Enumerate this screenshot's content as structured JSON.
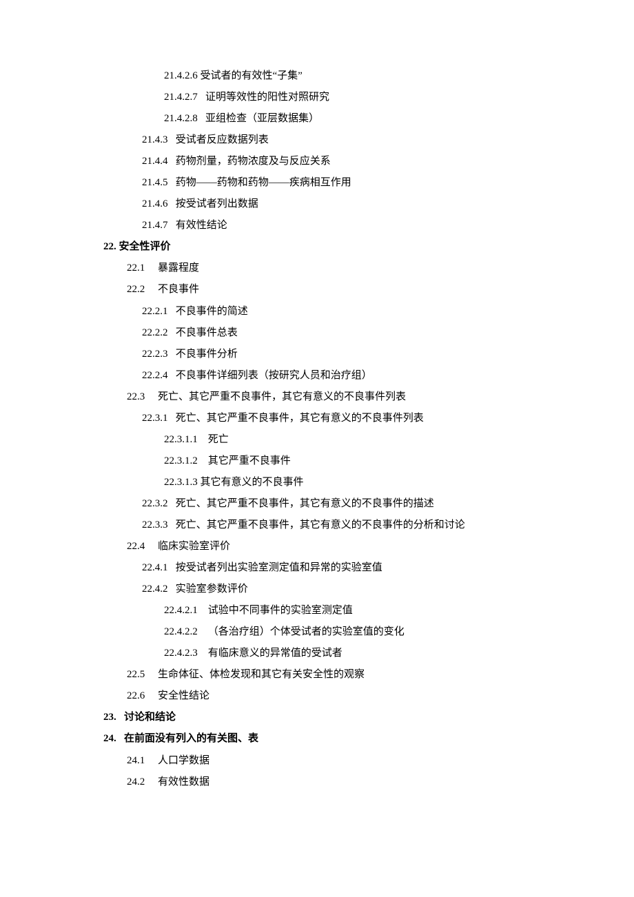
{
  "lines": [
    {
      "level": 3,
      "bold": false,
      "num": "21.4.2.6",
      "gap": " ",
      "text": "受试者的有效性“子集”"
    },
    {
      "level": 3,
      "bold": false,
      "num": "21.4.2.7",
      "gap": "   ",
      "text": "证明等效性的阳性对照研究"
    },
    {
      "level": 3,
      "bold": false,
      "num": "21.4.2.8",
      "gap": "   ",
      "text": "亚组检查（亚层数据集）"
    },
    {
      "level": 2,
      "bold": false,
      "num": "21.4.3",
      "gap": "   ",
      "text": "受试者反应数据列表"
    },
    {
      "level": 2,
      "bold": false,
      "num": "21.4.4",
      "gap": "   ",
      "text": "药物剂量，药物浓度及与反应关系"
    },
    {
      "level": 2,
      "bold": false,
      "num": "21.4.5",
      "gap": "   ",
      "text": "药物——药物和药物——疾病相互作用"
    },
    {
      "level": 2,
      "bold": false,
      "num": "21.4.6",
      "gap": "   ",
      "text": "按受试者列出数据"
    },
    {
      "level": 2,
      "bold": false,
      "num": "21.4.7",
      "gap": "   ",
      "text": "有效性结论"
    },
    {
      "level": 0,
      "bold": true,
      "num": "22.",
      "gap": " ",
      "text": "安全性评价"
    },
    {
      "level": 1,
      "bold": false,
      "num": "22.1",
      "gap": "     ",
      "text": "暴露程度"
    },
    {
      "level": 1,
      "bold": false,
      "num": "22.2",
      "gap": "     ",
      "text": "不良事件"
    },
    {
      "level": 2,
      "bold": false,
      "num": "22.2.1",
      "gap": "   ",
      "text": "不良事件的简述"
    },
    {
      "level": 2,
      "bold": false,
      "num": "22.2.2",
      "gap": "   ",
      "text": "不良事件总表"
    },
    {
      "level": 2,
      "bold": false,
      "num": "22.2.3",
      "gap": "   ",
      "text": "不良事件分析"
    },
    {
      "level": 2,
      "bold": false,
      "num": "22.2.4",
      "gap": "   ",
      "text": "不良事件详细列表（按研究人员和治疗组）"
    },
    {
      "level": 1,
      "bold": false,
      "num": "22.3",
      "gap": "     ",
      "text": "死亡、其它严重不良事件，其它有意义的不良事件列表"
    },
    {
      "level": 2,
      "bold": false,
      "num": "22.3.1",
      "gap": "   ",
      "text": "死亡、其它严重不良事件，其它有意义的不良事件列表"
    },
    {
      "level": 3,
      "bold": false,
      "num": "22.3.1.1",
      "gap": "    ",
      "text": "死亡"
    },
    {
      "level": 3,
      "bold": false,
      "num": "22.3.1.2",
      "gap": "    ",
      "text": "其它严重不良事件"
    },
    {
      "level": 3,
      "bold": false,
      "num": "22.3.1.3",
      "gap": " ",
      "text": "其它有意义的不良事件"
    },
    {
      "level": 2,
      "bold": false,
      "num": "22.3.2",
      "gap": "   ",
      "text": "死亡、其它严重不良事件，其它有意义的不良事件的描述"
    },
    {
      "level": 2,
      "bold": false,
      "num": "22.3.3",
      "gap": "   ",
      "text": "死亡、其它严重不良事件，其它有意义的不良事件的分析和讨论"
    },
    {
      "level": 1,
      "bold": false,
      "num": "22.4",
      "gap": "     ",
      "text": "临床实验室评价"
    },
    {
      "level": 2,
      "bold": false,
      "num": "22.4.1",
      "gap": "   ",
      "text": "按受试者列出实验室测定值和异常的实验室值"
    },
    {
      "level": 2,
      "bold": false,
      "num": "22.4.2",
      "gap": "   ",
      "text": "实验室参数评价"
    },
    {
      "level": 3,
      "bold": false,
      "num": "22.4.2.1",
      "gap": "    ",
      "text": "试验中不同事件的实验室测定值"
    },
    {
      "level": 3,
      "bold": false,
      "num": "22.4.2.2",
      "gap": "    ",
      "text": "（各治疗组）个体受试者的实验室值的变化"
    },
    {
      "level": 3,
      "bold": false,
      "num": "22.4.2.3",
      "gap": "    ",
      "text": "有临床意义的异常值的受试者"
    },
    {
      "level": 1,
      "bold": false,
      "num": "22.5",
      "gap": "     ",
      "text": "生命体征、体检发现和其它有关安全性的观察"
    },
    {
      "level": 1,
      "bold": false,
      "num": "22.6",
      "gap": "     ",
      "text": "安全性结论"
    },
    {
      "level": 0,
      "bold": true,
      "num": "23.",
      "gap": "   ",
      "text": "讨论和结论"
    },
    {
      "level": 0,
      "bold": true,
      "num": "24.",
      "gap": "   ",
      "text": "在前面没有列入的有关图、表"
    },
    {
      "level": 1,
      "bold": false,
      "num": "24.1",
      "gap": "     ",
      "text": "人口学数据"
    },
    {
      "level": 1,
      "bold": false,
      "num": "24.2",
      "gap": "     ",
      "text": "有效性数据"
    }
  ]
}
